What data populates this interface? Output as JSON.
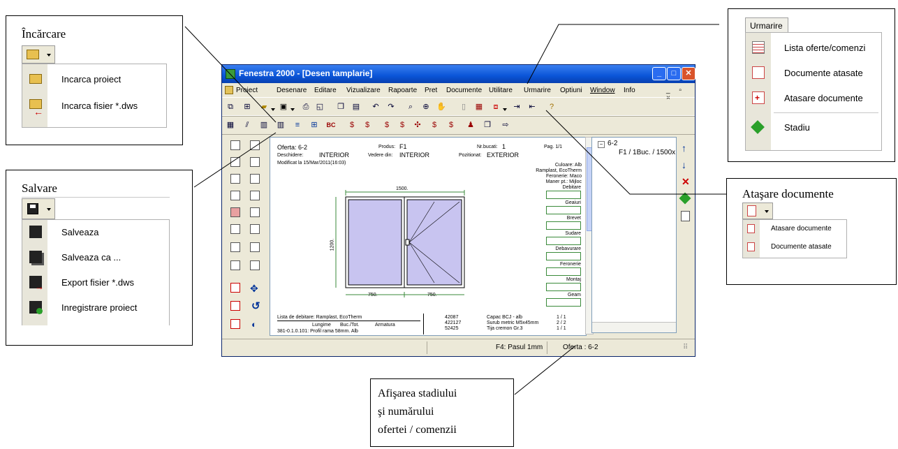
{
  "callouts": {
    "incarcare": {
      "title": "Încărcare",
      "items": [
        "Incarca proiect",
        "Incarca fisier *.dws"
      ]
    },
    "salvare": {
      "title": "Salvare",
      "items": [
        "Salveaza",
        "Salveaza ca ...",
        "Export fisier *.dws",
        "Inregistrare proiect"
      ]
    },
    "urmarire": {
      "tab": "Urmarire",
      "items": [
        "Lista oferte/comenzi",
        "Documente atasate",
        "Atasare documente",
        "Stadiu"
      ]
    },
    "atasare": {
      "title": "Ataşare documente",
      "items": [
        "Atasare documente",
        "Documente atasate"
      ]
    },
    "afisare": {
      "lines": [
        "Afişarea stadiului",
        "şi numărului",
        "ofertei / comenzii"
      ]
    }
  },
  "window": {
    "title": "Fenestra 2000 - [Desen tamplarie]",
    "menu": [
      "Proiect",
      "Desenare",
      "Editare",
      "Vizualizare",
      "Rapoarte",
      "Pret",
      "Documente",
      "Utilitare",
      "Urmarire",
      "Optiuni",
      "Window",
      "Info"
    ],
    "status": {
      "hint": "F4: Pasul 1mm",
      "offer": "Oferta : 6-2"
    },
    "tree": {
      "root": "6-2",
      "child": "F1 / 1Buc. / 1500x"
    }
  },
  "drawing": {
    "oferta": "Oferta: 6-2",
    "produs_label": "Produs:",
    "produs": "F1",
    "nrbucati_label": "Nr.bucati:",
    "nrbucati": "1",
    "pag": "Pag. 1/1",
    "deschidere_label": "Deschidere:",
    "deschidere": "INTERIOR",
    "vedere_label": "Vedere din:",
    "vedere": "INTERIOR",
    "pozitionat_label": "Pozitionat:",
    "pozitionat": "EXTERIOR",
    "modificat": "Modificat la 15/Mar/2011(16:03)",
    "right_info": [
      "Culoare: Alb",
      "Ramplast, EcoTherm",
      "Feronerie: Maco",
      "Maner pt.: Mijloc"
    ],
    "dim_top": "1500.",
    "dim_left": "1200.",
    "dim_b1": "750.",
    "dim_b2": "750.",
    "right_boxes": [
      "Debitare",
      "Geaiuri",
      "Brevet",
      "Sudare",
      "Debavurare",
      "Feronerie",
      "Montaj",
      "Geam"
    ],
    "bottom_title": "Lista de debitare: Ramplast, EcoTherm",
    "bottom_cols": [
      "Lungime",
      "Buc./Tot.",
      "Armatura"
    ],
    "bottom_row": "381-0.1.0.101: Profil rama 58mm. Alb",
    "codes": [
      "42087",
      "422127",
      "52425"
    ],
    "descr": [
      "Capac BCJ - alb",
      "Surub metric M5x45mm",
      "Tija cremon Gr.3"
    ],
    "qty": [
      "1 / 1",
      "2 / 2",
      "1 / 1"
    ]
  }
}
